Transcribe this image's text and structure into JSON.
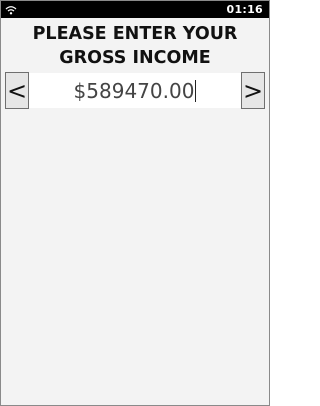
{
  "status_bar": {
    "time": "01:16",
    "wifi_icon": "wifi-icon"
  },
  "prompt": {
    "title": "PLEASE ENTER YOUR GROSS INCOME"
  },
  "income_entry": {
    "value": "$589470.00",
    "prev_label": "<",
    "next_label": ">"
  },
  "colors": {
    "status_bar_bg": "#000000",
    "screen_bg": "#f3f3f3",
    "field_bg": "#ffffff"
  }
}
